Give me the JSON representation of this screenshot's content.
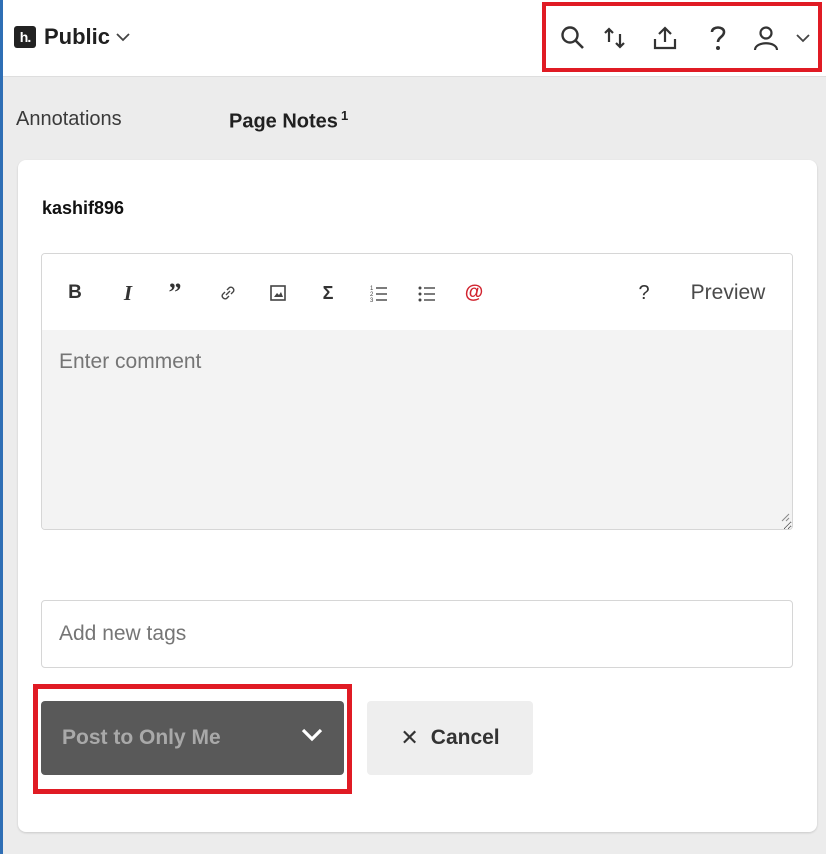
{
  "header": {
    "logo_text": "h.",
    "group_name": "Public",
    "icons": [
      "search-icon",
      "sort-icon",
      "share-icon",
      "help-icon",
      "user-icon",
      "chevron-down-icon"
    ]
  },
  "tabs": {
    "annotations_label": "Annotations",
    "page_notes_label": "Page Notes",
    "page_notes_count": "1"
  },
  "note": {
    "username": "kashif896",
    "editor": {
      "toolbar": {
        "bold": "B",
        "italic": "I",
        "quote": "”",
        "math": "Σ",
        "mention": "@",
        "help": "?",
        "preview_label": "Preview"
      },
      "placeholder": "Enter comment"
    },
    "tags_placeholder": "Add new tags",
    "post_label": "Post to Only Me",
    "cancel_x": "✕",
    "cancel_label": "Cancel"
  },
  "colors": {
    "highlight": "#e01b24",
    "post_button": "#595959",
    "mention": "#d1242f",
    "frame": "#2f6fb5"
  }
}
